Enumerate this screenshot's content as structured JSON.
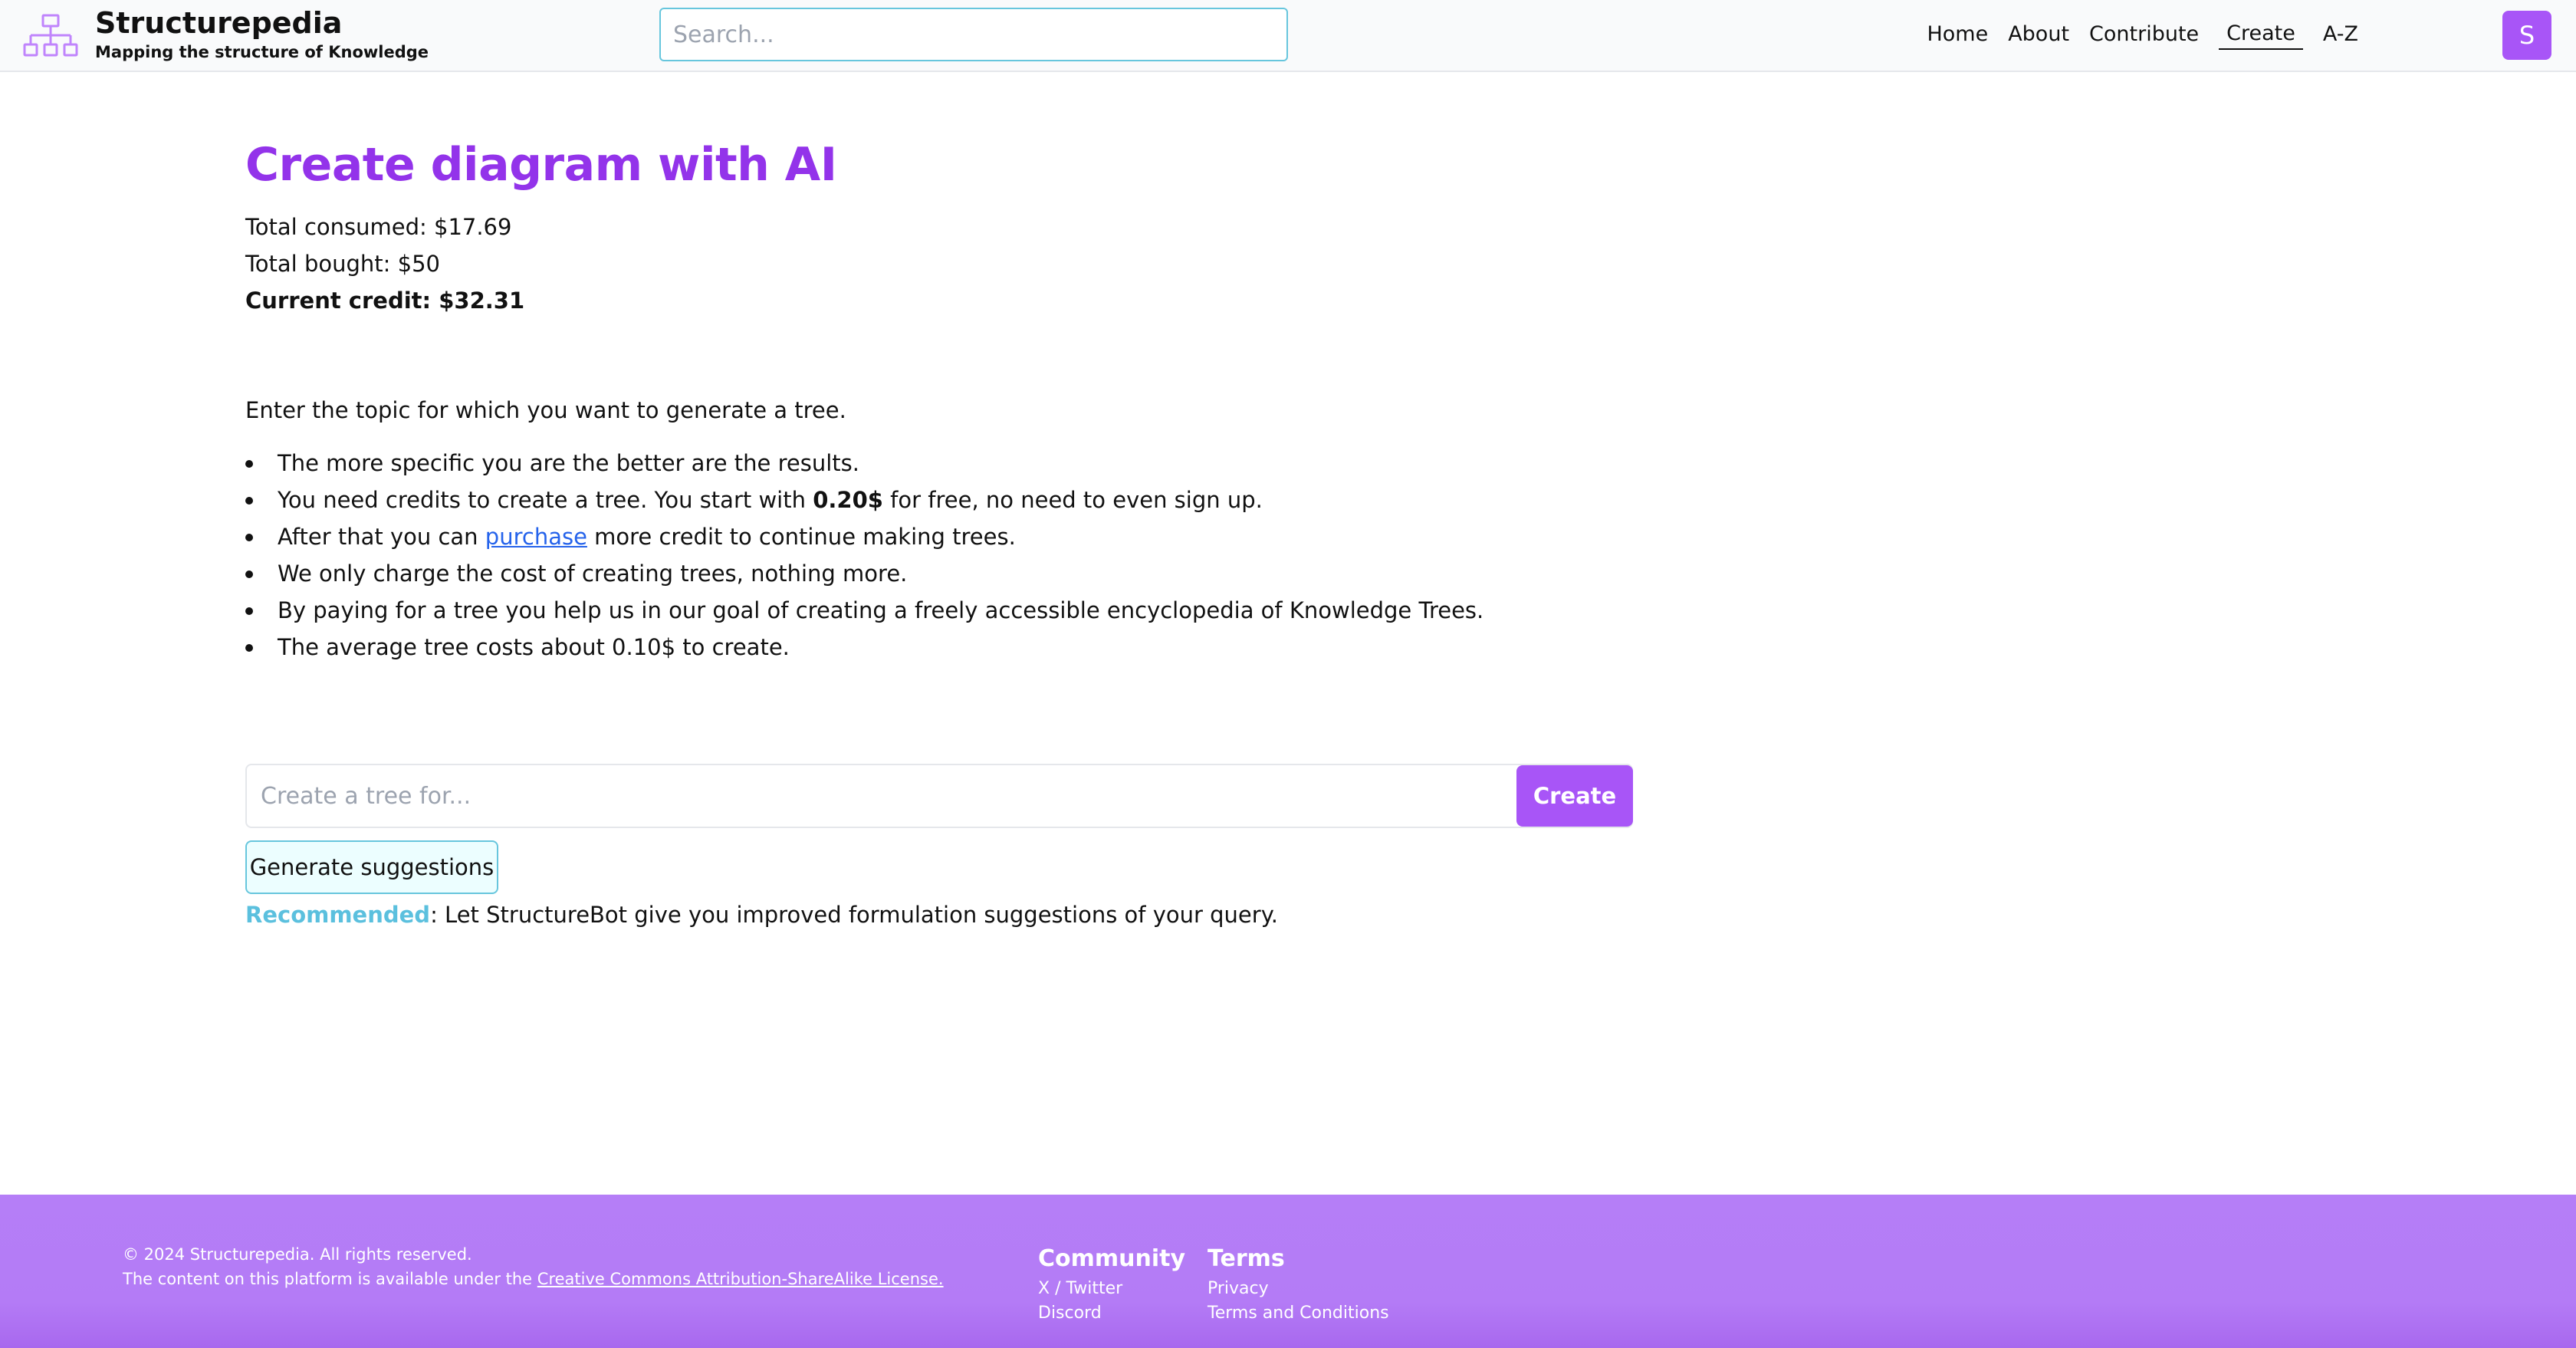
{
  "header": {
    "brand_title": "Structurepedia",
    "brand_tagline": "Mapping the structure of Knowledge",
    "search_placeholder": "Search...",
    "nav": [
      {
        "label": "Home"
      },
      {
        "label": "About"
      },
      {
        "label": "Contribute"
      },
      {
        "label": "Create",
        "active": true
      },
      {
        "label": "A-Z"
      }
    ],
    "avatar_letter": "S"
  },
  "main": {
    "title": "Create diagram with AI",
    "total_consumed": "Total consumed: $17.69",
    "total_bought": "Total bought: $50",
    "current_credit": "Current credit: $32.31",
    "intro": "Enter the topic for which you want to generate a tree.",
    "bullets": {
      "b1": "The more specific you are the better are the results.",
      "b2_pre": "You need credits to create a tree. You start with ",
      "b2_strong": "0.20$",
      "b2_post": " for free, no need to even sign up.",
      "b3_pre": "After that you can ",
      "b3_link": "purchase",
      "b3_post": " more credit to continue making trees.",
      "b4": "We only charge the cost of creating trees, nothing more.",
      "b5": "By paying for a tree you help us in our goal of creating a freely accessible encyclopedia of Knowledge Trees.",
      "b6": "The average tree costs about 0.10$ to create."
    },
    "create_placeholder": "Create a tree for...",
    "create_button": "Create",
    "suggest_button": "Generate suggestions",
    "recommend_label": "Recommended",
    "recommend_text": ": Let StructureBot give you improved formulation suggestions of your query."
  },
  "footer": {
    "copyright": "© 2024 Structurepedia. All rights reserved.",
    "license_pre": "The content on this platform is available under the ",
    "license_link": "Creative Commons Attribution-ShareAlike License.",
    "community_heading": "Community",
    "community_links": [
      "X / Twitter",
      "Discord"
    ],
    "terms_heading": "Terms",
    "terms_links": [
      "Privacy",
      "Terms and Conditions"
    ]
  },
  "colors": {
    "accent_purple": "#a855f7",
    "title_purple": "#9333ea",
    "accent_cyan": "#67c6dd",
    "footer_bg": "#b57ef7"
  },
  "icons": {
    "logo": "hierarchy-tree-icon"
  }
}
